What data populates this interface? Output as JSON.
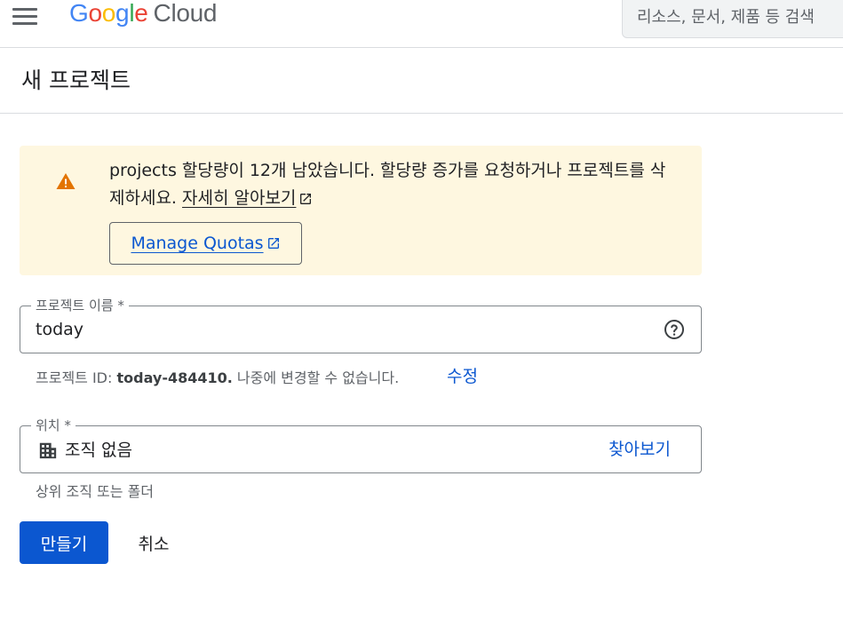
{
  "header": {
    "logo_google": "Google",
    "logo_cloud": "Cloud",
    "search_placeholder": "리소스, 문서, 제품 등 검색"
  },
  "page": {
    "title": "새 프로젝트"
  },
  "warning": {
    "text": "projects 할당량이 12개 남았습니다. 할당량 증가를 요청하거나 프로젝트를 삭제하세요.",
    "learn_more": "자세히 알아보기",
    "manage_button": "Manage Quotas"
  },
  "project_name": {
    "label": "프로젝트 이름 *",
    "value": "today"
  },
  "project_id": {
    "prefix": "프로젝트 ID: ",
    "id": "today-484410.",
    "suffix": " 나중에 변경할 수 없습니다.",
    "edit": "수정"
  },
  "location": {
    "label": "위치 *",
    "value": "조직 없음",
    "browse": "찾아보기",
    "hint": "상위 조직 또는 폴더"
  },
  "actions": {
    "create": "만들기",
    "cancel": "취소"
  },
  "colors": {
    "accent": "#0b57d0",
    "warning_bg": "#fef7e0",
    "warning_icon": "#e37400"
  }
}
